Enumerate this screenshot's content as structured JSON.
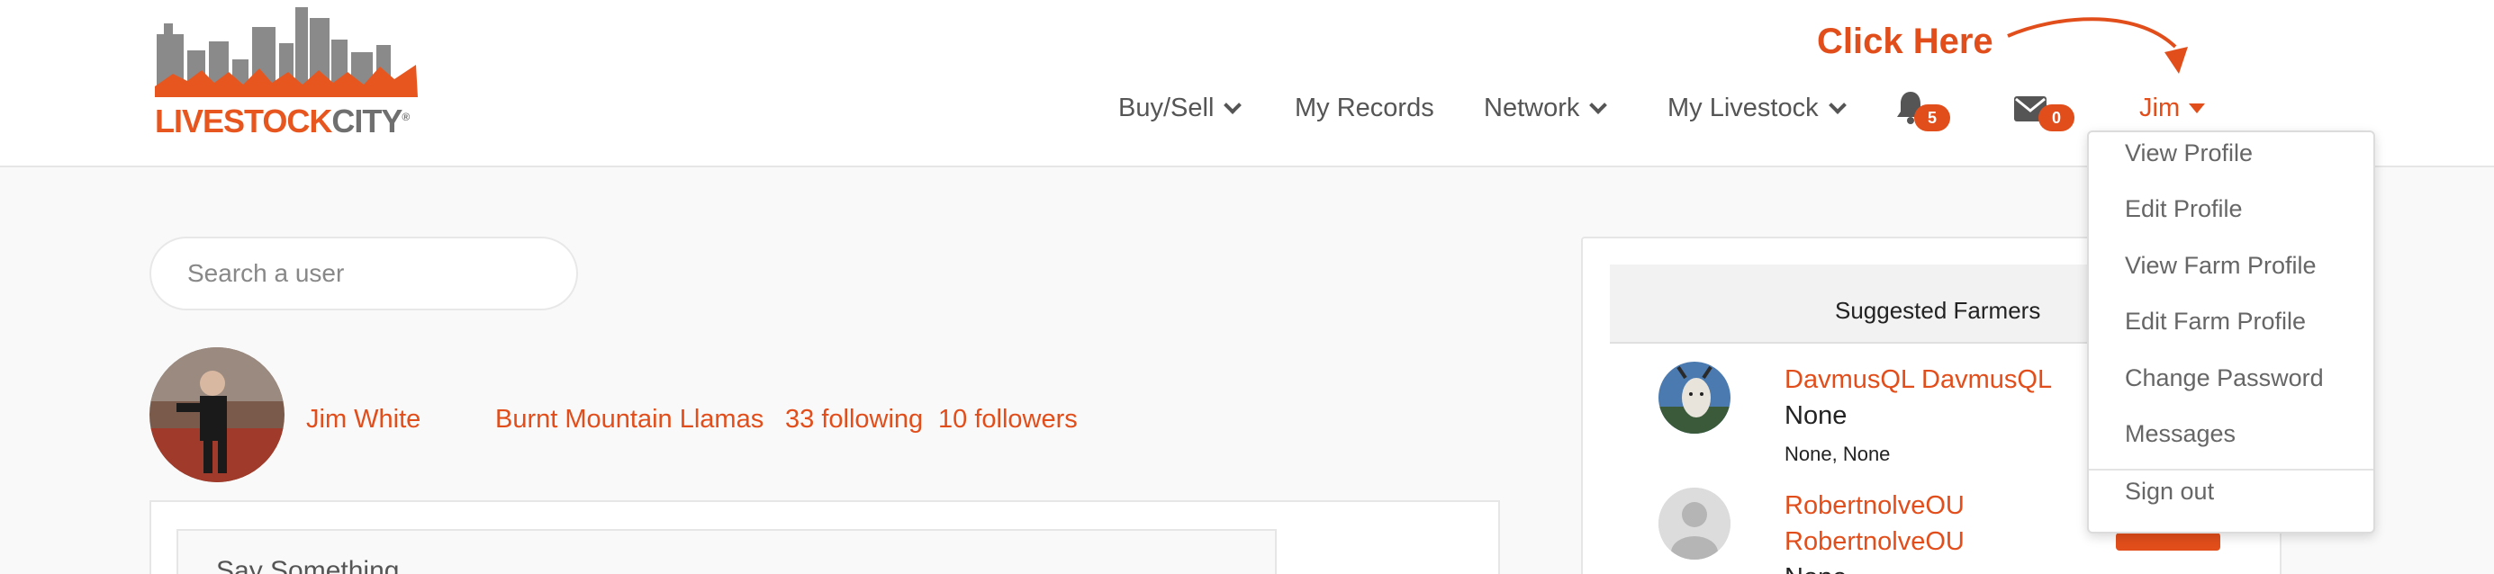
{
  "logo": {
    "part1": "LIVESTOCK",
    "part2": "CITY",
    "mark": "®"
  },
  "nav": {
    "buy_sell": "Buy/Sell",
    "my_records": "My Records",
    "network": "Network",
    "my_livestock": "My Livestock",
    "notifications_count": "5",
    "messages_count": "0",
    "user_name": "Jim"
  },
  "annotation": {
    "click_here": "Click Here"
  },
  "search": {
    "placeholder": "Search a user"
  },
  "profile": {
    "name": "Jim White",
    "farm": "Burnt Mountain Llamas",
    "following": "33 following",
    "followers": "10 followers"
  },
  "post": {
    "prompt": "Say Something"
  },
  "suggested": {
    "title": "Suggested Farmers",
    "farmers": [
      {
        "name": "DavmusQL DavmusQL",
        "type": "None",
        "location": "None, None"
      },
      {
        "name_line1": "RobertnolveOU",
        "name_line2": "RobertnolveOU",
        "type": "None"
      }
    ]
  },
  "dropdown": {
    "items": [
      "View Profile",
      "Edit Profile",
      "View Farm Profile",
      "Edit Farm Profile",
      "Change Password",
      "Messages"
    ],
    "sign_out": "Sign out"
  },
  "colors": {
    "accent": "#e24e1b",
    "logo_grey": "#6f6f6f"
  }
}
